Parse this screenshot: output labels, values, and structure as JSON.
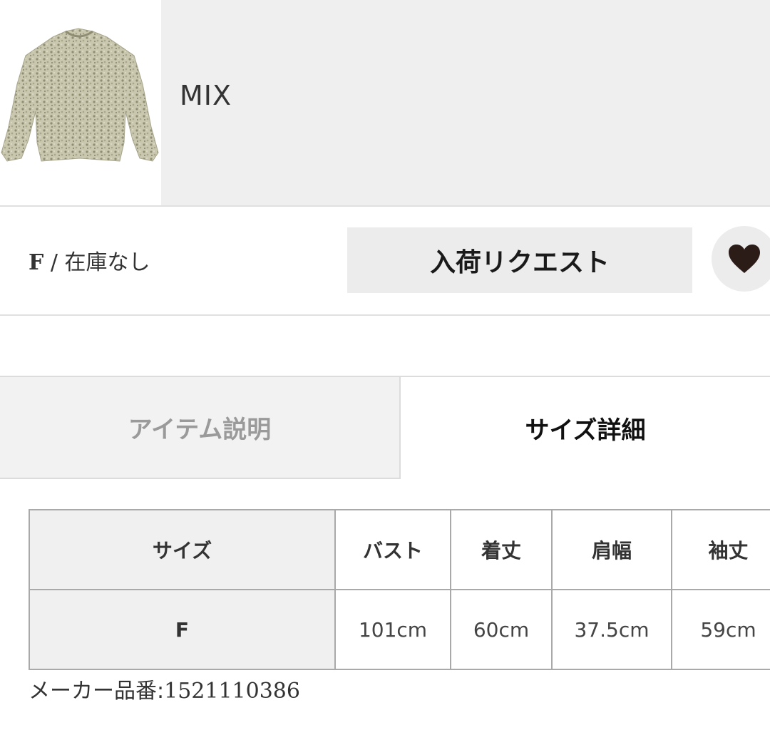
{
  "color_option": {
    "label": "MIX"
  },
  "stock": {
    "size": "F",
    "separator": " / ",
    "status": "在庫なし"
  },
  "request_button": {
    "label": "入荷リクエスト"
  },
  "tabs": [
    {
      "label": "アイテム説明",
      "active": false
    },
    {
      "label": "サイズ詳細",
      "active": true
    }
  ],
  "size_table": {
    "headers": [
      "サイズ",
      "バスト",
      "着丈",
      "肩幅",
      "袖丈"
    ],
    "rows": [
      [
        "F",
        "101cm",
        "60cm",
        "37.5cm",
        "59cm"
      ]
    ]
  },
  "maker_code": {
    "label": "メーカー品番:",
    "value": "1521110386"
  },
  "icons": {
    "favorite": "heart-icon"
  },
  "colors": {
    "panel_bg": "#efefef",
    "button_bg": "#ececec",
    "heart": "#2b1c18"
  }
}
